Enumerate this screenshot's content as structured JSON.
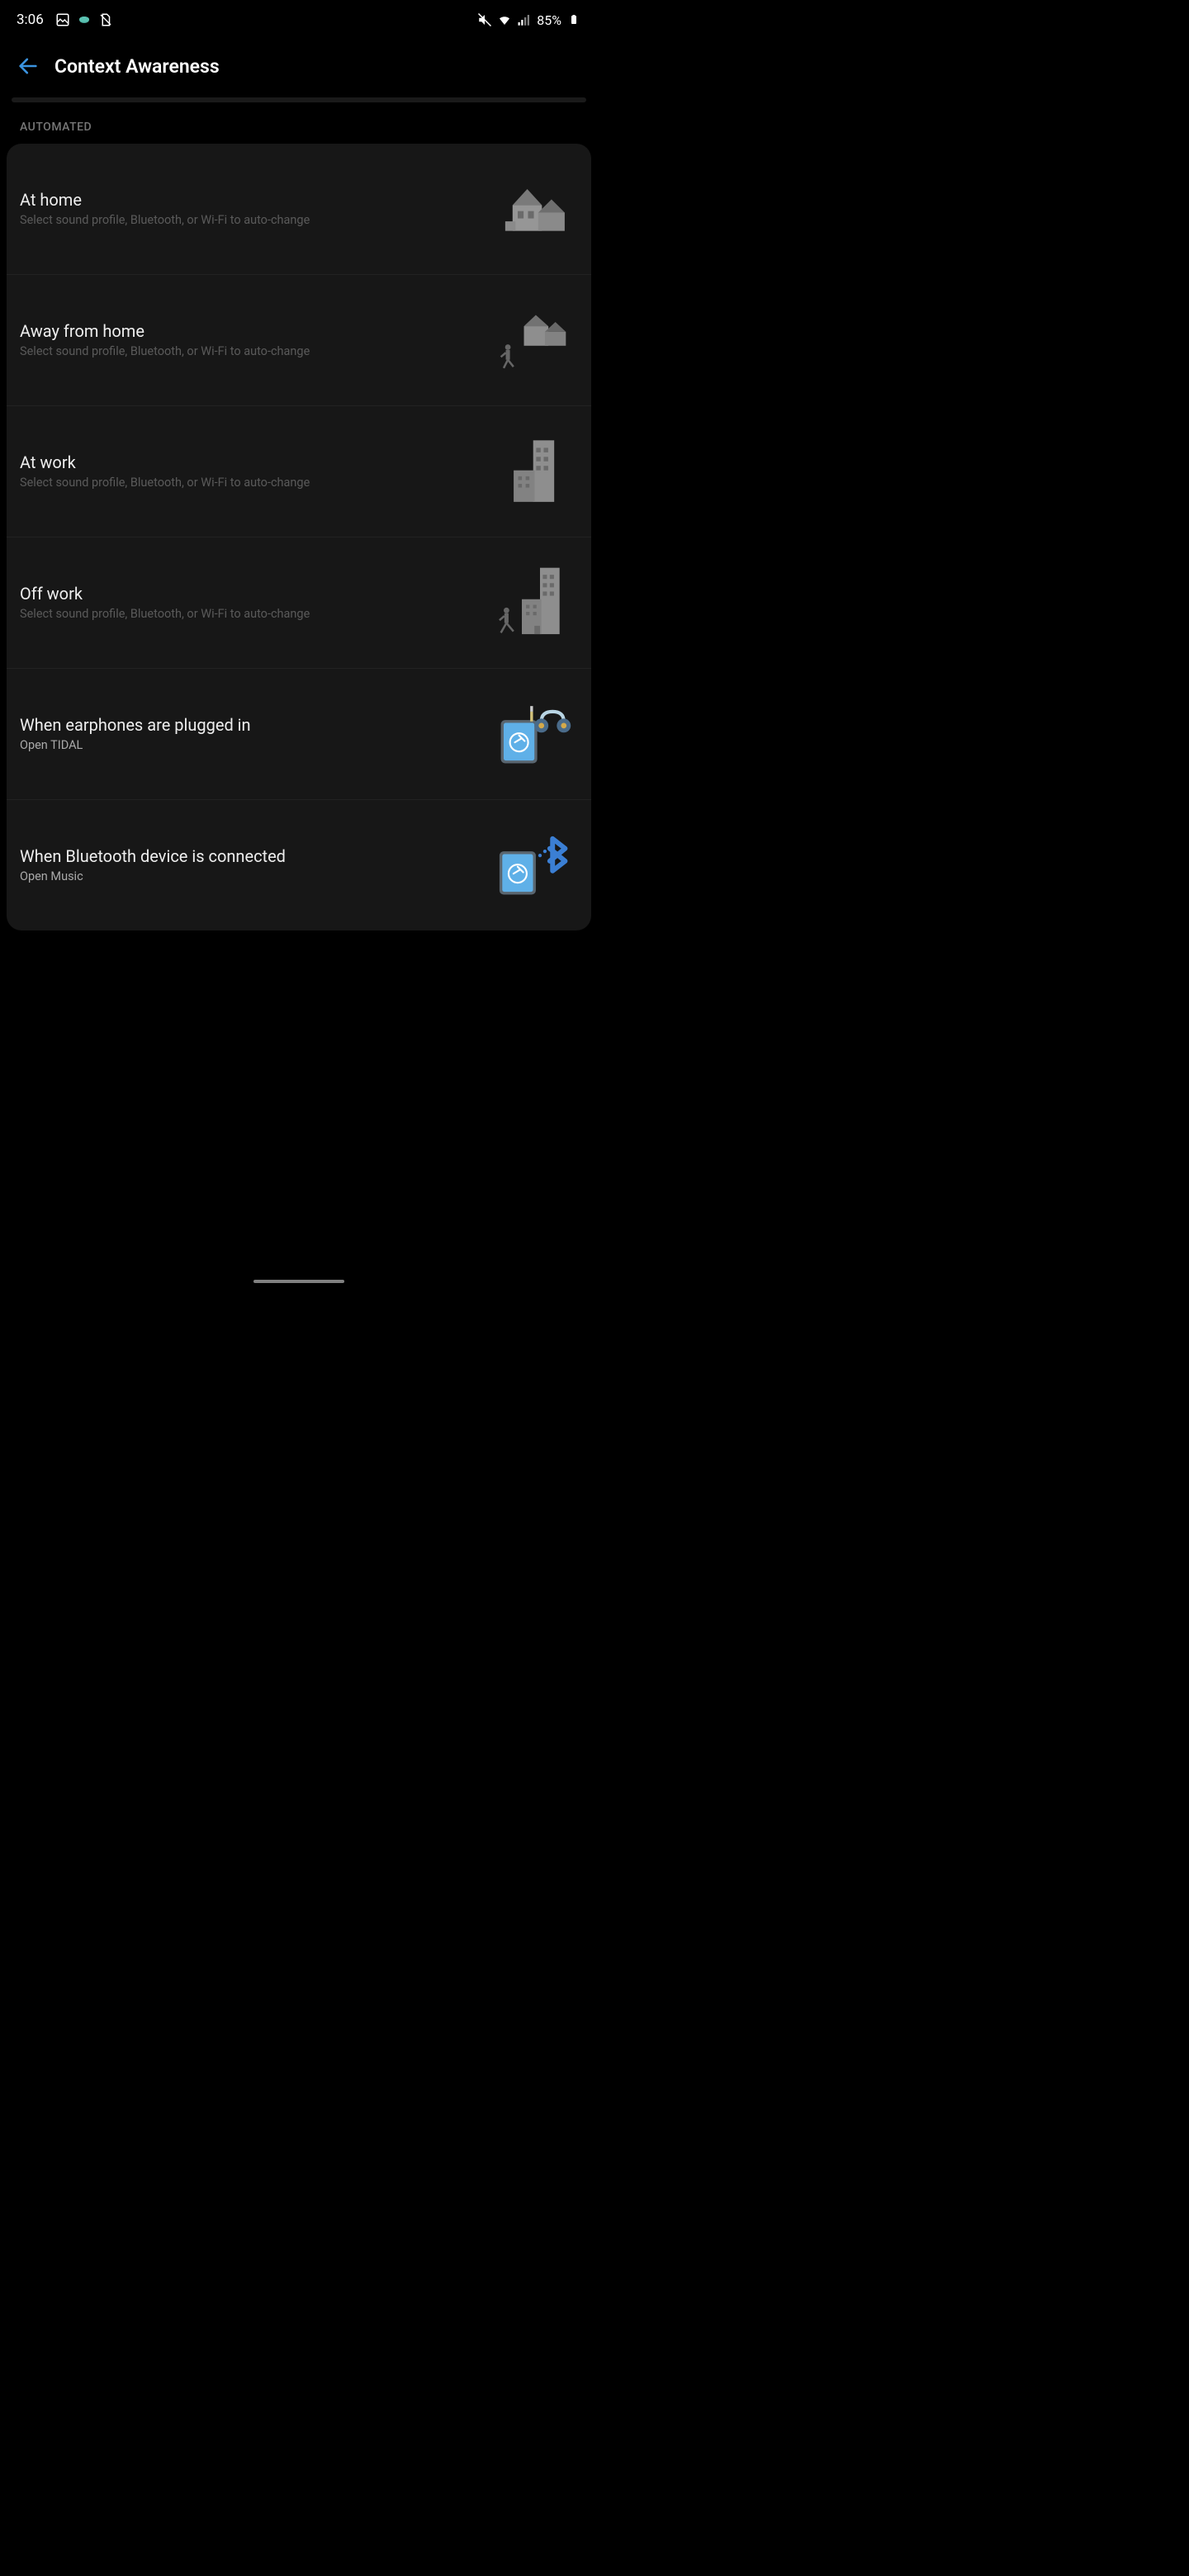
{
  "status": {
    "time": "3:06",
    "battery": "85%"
  },
  "header": {
    "title": "Context Awareness"
  },
  "section_label": "AUTOMATED",
  "items": [
    {
      "title": "At home",
      "subtitle": "Select sound profile, Bluetooth, or Wi-Fi to auto-change",
      "icon": "house",
      "bright": false
    },
    {
      "title": "Away from home",
      "subtitle": "Select sound profile, Bluetooth, or Wi-Fi to auto-change",
      "icon": "house-walk",
      "bright": false
    },
    {
      "title": "At work",
      "subtitle": "Select sound profile, Bluetooth, or Wi-Fi to auto-change",
      "icon": "building",
      "bright": false
    },
    {
      "title": "Off work",
      "subtitle": "Select sound profile, Bluetooth, or Wi-Fi to auto-change",
      "icon": "building-walk",
      "bright": false
    },
    {
      "title": "When earphones are plugged in",
      "subtitle": "Open TIDAL",
      "icon": "phone-earphones",
      "bright": true
    },
    {
      "title": "When Bluetooth device is connected",
      "subtitle": "Open Music",
      "icon": "phone-bluetooth",
      "bright": true
    }
  ]
}
